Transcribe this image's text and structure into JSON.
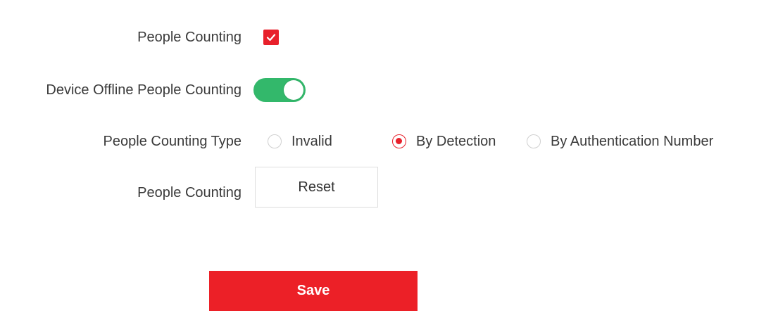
{
  "form": {
    "people_counting_label": "People Counting",
    "people_counting_checked": true,
    "offline_label": "Device Offline People Counting",
    "offline_enabled": true,
    "type_label": "People Counting Type",
    "type_options": [
      {
        "label": "Invalid",
        "selected": false
      },
      {
        "label": "By Detection",
        "selected": true
      },
      {
        "label": "By Authentication Number",
        "selected": false
      }
    ],
    "reset_row_label": "People Counting",
    "reset_button_label": "Reset",
    "save_button_label": "Save"
  },
  "colors": {
    "accent_red": "#e8202b",
    "toggle_green": "#33b86b"
  }
}
